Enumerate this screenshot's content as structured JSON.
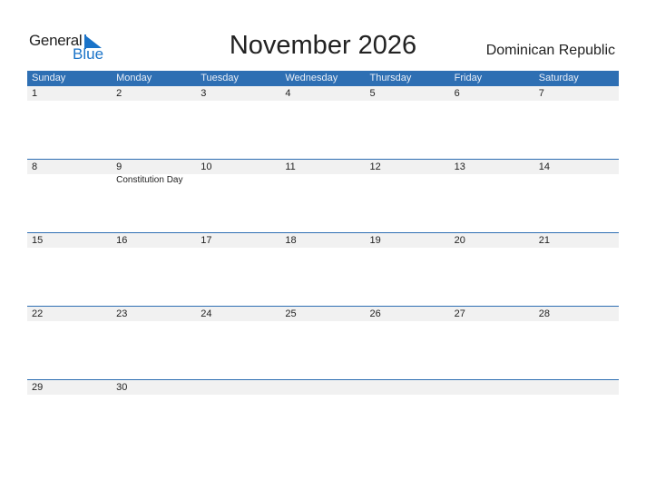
{
  "logo": {
    "general": "General",
    "blue": "Blue"
  },
  "title": "November 2026",
  "country": "Dominican Republic",
  "colors": {
    "header_bg": "#2e6fb3",
    "row_bg": "#f1f1f1",
    "brand": "#1a73c8"
  },
  "weekdays": [
    "Sunday",
    "Monday",
    "Tuesday",
    "Wednesday",
    "Thursday",
    "Friday",
    "Saturday"
  ],
  "weeks": [
    {
      "days": [
        "1",
        "2",
        "3",
        "4",
        "5",
        "6",
        "7"
      ],
      "events": [
        "",
        "",
        "",
        "",
        "",
        "",
        ""
      ]
    },
    {
      "days": [
        "8",
        "9",
        "10",
        "11",
        "12",
        "13",
        "14"
      ],
      "events": [
        "",
        "Constitution Day",
        "",
        "",
        "",
        "",
        ""
      ]
    },
    {
      "days": [
        "15",
        "16",
        "17",
        "18",
        "19",
        "20",
        "21"
      ],
      "events": [
        "",
        "",
        "",
        "",
        "",
        "",
        ""
      ]
    },
    {
      "days": [
        "22",
        "23",
        "24",
        "25",
        "26",
        "27",
        "28"
      ],
      "events": [
        "",
        "",
        "",
        "",
        "",
        "",
        ""
      ]
    },
    {
      "days": [
        "29",
        "30",
        "",
        "",
        "",
        "",
        ""
      ],
      "events": [
        "",
        "",
        "",
        "",
        "",
        "",
        ""
      ]
    }
  ]
}
